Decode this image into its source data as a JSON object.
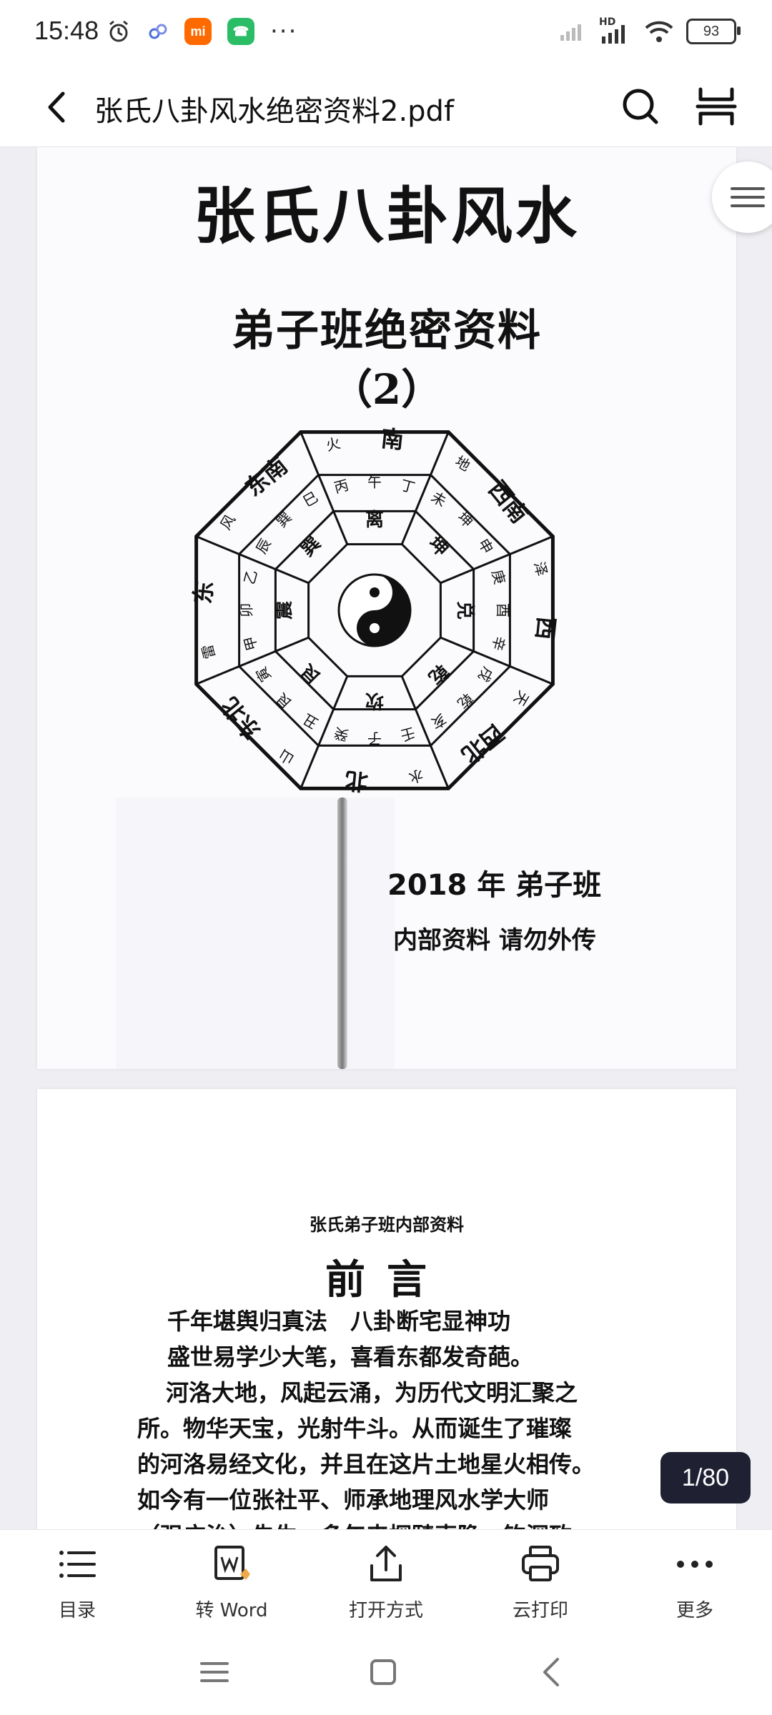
{
  "status_bar": {
    "time": "15:48",
    "apps": [
      {
        "text": "mi",
        "color": "#ff6a00"
      },
      {
        "text": "☎",
        "color": "#2bbd66"
      }
    ],
    "more": "···",
    "network": "HD",
    "battery": "93"
  },
  "header": {
    "title": "张氏八卦风水绝密资料2.pdf"
  },
  "page1": {
    "title": "张氏八卦风水",
    "subtitle": "弟子班绝密资料",
    "number": "（2）",
    "year_line": "2018 年 弟子班",
    "note": "内部资料 请勿外传",
    "bagua": {
      "directions": [
        "南",
        "西南",
        "西",
        "西北",
        "北",
        "东北",
        "东",
        "东南"
      ],
      "elements": [
        "火",
        "地",
        "泽",
        "天",
        "水",
        "山",
        "雷",
        "风"
      ],
      "trigrams": [
        "离",
        "坤",
        "兑",
        "乾",
        "坎",
        "艮",
        "震",
        "巽"
      ],
      "branches": [
        "丙",
        "午",
        "丁",
        "未",
        "坤",
        "申",
        "庚",
        "酉",
        "辛",
        "戌",
        "乾",
        "亥",
        "壬",
        "子",
        "癸",
        "丑",
        "艮",
        "寅",
        "甲",
        "卯",
        "乙",
        "辰",
        "巽",
        "巳"
      ]
    }
  },
  "page2": {
    "header": "张氏弟子班内部资料",
    "title": "前言",
    "lines": [
      "千年堪舆归真法　八卦断宅显神功",
      "盛世易学少大笔，喜看东都发奇葩。",
      "河洛大地，风起云涌，为历代文明汇聚之",
      "所。物华天宝，光射牛斗。从而诞生了璀璨",
      "的河洛易经文化，并且在这片土地星火相传。",
      "如今有一位张社平、师承地理风水学大师",
      "（强广治）先生，多年来探赜索隐、钩深致"
    ]
  },
  "page_indicator": "1/80",
  "bottom_bar": {
    "items": [
      "目录",
      "转 Word",
      "打开方式",
      "云打印",
      "更多"
    ]
  }
}
